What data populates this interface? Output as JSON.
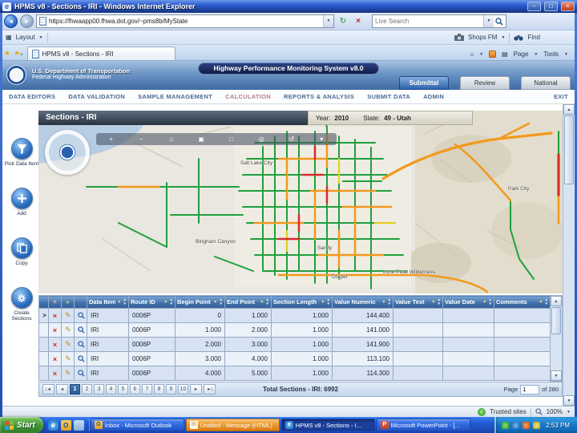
{
  "window": {
    "title": "HPMS v8 - Sections - IRI - Windows Internet Explorer"
  },
  "browser": {
    "url": "https://fhwaapp00.fhwa.dot.gov/~pms8b/MyState",
    "search_placeholder": "Live Search",
    "layout_button": "Layout",
    "capture_button": "Shops FM",
    "find_button": "Find",
    "tab_title": "HPMS v8 - Sections - IRI",
    "page_menu": "Page",
    "tools_menu": "Tools",
    "status_zone": "Trusted sites",
    "zoom_level": "100%"
  },
  "app": {
    "agency_line1": "U.S. Department of Transportation",
    "agency_line2": "Federal Highway Administration",
    "title": "Highway Performance Monitoring System v8.0",
    "mode_buttons": [
      "Submittal",
      "Review",
      "National"
    ],
    "nav_items": [
      "DATA EDITORS",
      "DATA VALIDATION",
      "SAMPLE MANAGEMENT",
      "CALCULATION",
      "REPORTS & ANALYSIS",
      "SUBMIT DATA",
      "ADMIN"
    ],
    "exit_label": "EXIT"
  },
  "page": {
    "title": "Sections - IRI",
    "year_label": "Year:",
    "year": "2010",
    "state_label": "State:",
    "state": "49 - Utah"
  },
  "tools": [
    {
      "label": "Pick Data Item"
    },
    {
      "label": "Add"
    },
    {
      "label": "Copy"
    },
    {
      "label": "Create Sections"
    }
  ],
  "map": {
    "labels": [
      {
        "text": "Salt Lake City"
      },
      {
        "text": "Sandy"
      },
      {
        "text": "Draper"
      },
      {
        "text": "Bingham Canyon"
      },
      {
        "text": "Lone Peak Wilderness"
      },
      {
        "text": "Park City"
      }
    ],
    "toolbar_glyphs": [
      "+",
      "−",
      "⌂",
      "▣",
      "□",
      "◎",
      "↺",
      "▾"
    ],
    "road_colors": {
      "good": "#1fa03c",
      "fair": "#f2991d",
      "poor": "#d92b2b",
      "caution": "#e5cf1e"
    }
  },
  "table": {
    "columns": [
      "Data Item",
      "Route ID",
      "Begin Point",
      "End Point",
      "Section Length",
      "Value Numeric",
      "Value Text",
      "Value Date",
      "Comments"
    ],
    "rows": [
      {
        "c0": "IRI",
        "c1": "0006P",
        "c2": "0",
        "c3": "1.000",
        "c4": "1.000",
        "c5": "144.400",
        "c6": "",
        "c7": "",
        "c8": ""
      },
      {
        "c0": "IRI",
        "c1": "0006P",
        "c2": "1.000",
        "c3": "2.000",
        "c4": "1.000",
        "c5": "141.000",
        "c6": "",
        "c7": "",
        "c8": ""
      },
      {
        "c0": "IRI",
        "c1": "0006P",
        "c2": "2.000",
        "c3": "3.000",
        "c4": "1.000",
        "c5": "141.900",
        "c6": "",
        "c7": "",
        "c8": ""
      },
      {
        "c0": "IRI",
        "c1": "0006P",
        "c2": "3.000",
        "c3": "4.000",
        "c4": "1.000",
        "c5": "113.100",
        "c6": "",
        "c7": "",
        "c8": ""
      },
      {
        "c0": "IRI",
        "c1": "0006P",
        "c2": "4.000",
        "c3": "5.000",
        "c4": "1.000",
        "c5": "114.300",
        "c6": "",
        "c7": "",
        "c8": ""
      }
    ]
  },
  "pagination": {
    "pages": [
      "1",
      "2",
      "3",
      "4",
      "5",
      "6",
      "7",
      "8",
      "9",
      "10"
    ],
    "total": "Total Sections - IRI: 6992",
    "page_label": "Page",
    "current_page": "1",
    "of_label": "of 280"
  },
  "taskbar": {
    "start_label": "Start",
    "tasks": [
      {
        "label": "Inbox - Microsoft Outlook"
      },
      {
        "label": "Untitled - Message (HTML)"
      },
      {
        "label": "HPMS v8 - Sections - I..."
      },
      {
        "label": "Microsoft PowerPoint - [..."
      }
    ],
    "time": "2:53 PM"
  },
  "icons": {
    "minimize": "−",
    "maximize": "□",
    "close": "×",
    "ie_logo": "e",
    "back": "◄",
    "forward": "►",
    "dropdown": "▼",
    "refresh": "↻",
    "stop": "×",
    "favorites_star": "★",
    "add_favorite": "+",
    "home": "⌂",
    "print": "▤",
    "layout_grid": "▦",
    "row_delete": "×",
    "row_edit": "✎",
    "selector": ">",
    "funnel": "▼",
    "sort_asc": "▲",
    "sort_desc": "▼",
    "pager_first": "|◄",
    "pager_prev": "◄",
    "pager_next": "►",
    "pager_last": "►|",
    "check": "✓",
    "mail": "✉",
    "outlook_logo": "O",
    "ppt_logo": "P"
  }
}
